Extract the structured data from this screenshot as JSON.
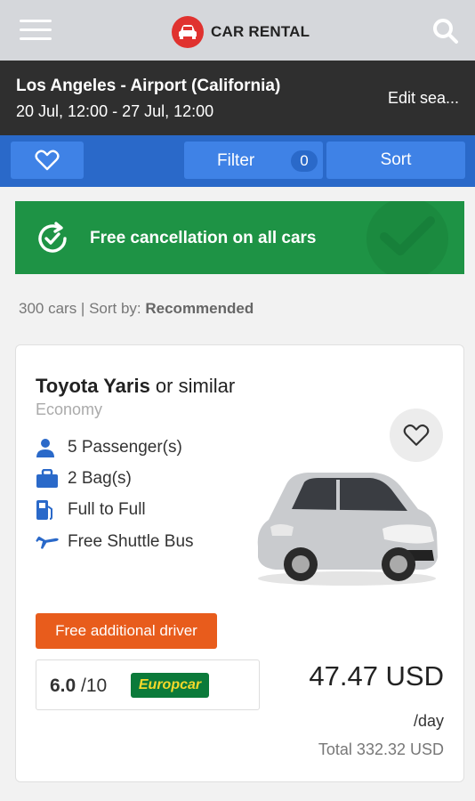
{
  "header": {
    "logo_text": "CAR RENTAL",
    "menu_icon": "hamburger-icon",
    "search_icon": "search-icon"
  },
  "search": {
    "location": "Los Angeles - Airport (California)",
    "dates": "20 Jul, 12:00 - 27 Jul, 12:00",
    "edit_label": "Edit sea..."
  },
  "actions": {
    "filter_label": "Filter",
    "filter_count": "0",
    "sort_label": "Sort"
  },
  "banner": {
    "text": "Free cancellation on all cars"
  },
  "results": {
    "count_text": "300 cars | Sort by: ",
    "sort_value": "Recommended"
  },
  "car": {
    "model": "Toyota Yaris",
    "similar": " or similar",
    "category": "Economy",
    "features": {
      "passengers": "5 Passenger(s)",
      "bags": "2 Bag(s)",
      "fuel": "Full to Full",
      "shuttle": "Free Shuttle Bus"
    },
    "badge": "Free additional driver",
    "rating": "6.0",
    "rating_max": " /10",
    "supplier": "Europcar",
    "price": "47.47 USD",
    "per_day": "/day",
    "total": "Total 332.32 USD"
  },
  "colors": {
    "brand_red": "#e0322f",
    "action_blue": "#2a69c9",
    "banner_green": "#1e9345",
    "badge_orange": "#e85c1c"
  }
}
